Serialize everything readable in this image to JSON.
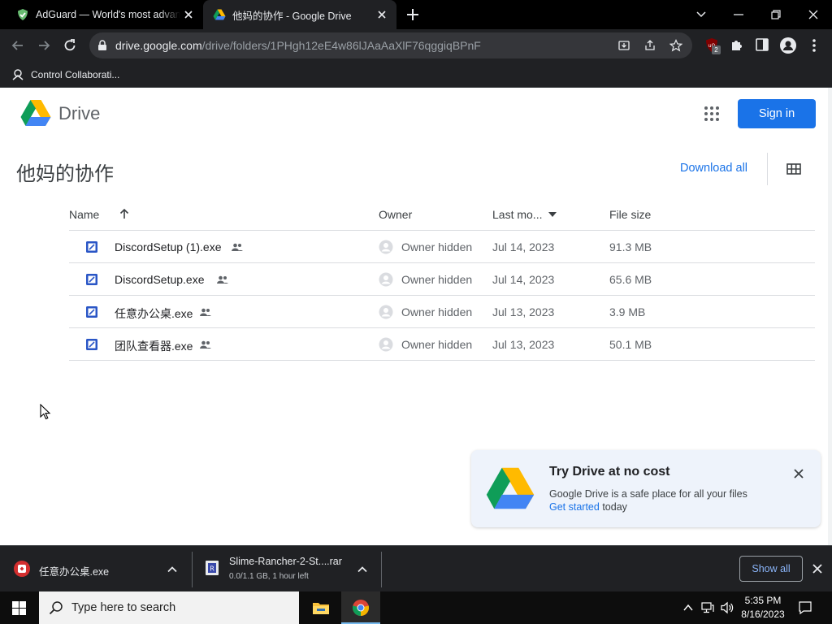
{
  "browser": {
    "tabs": [
      {
        "title": "AdGuard — World's most advanced",
        "active": false
      },
      {
        "title": "他妈的协作 - Google Drive",
        "active": true
      }
    ],
    "url_host": "drive.google.com",
    "url_path": "/drive/folders/1PHgh12eE4w86lJAaAaXlF76qggiqBPnF",
    "extension_badge": "2",
    "bookmarks": [
      {
        "label": "Control Collaborati..."
      }
    ]
  },
  "drive": {
    "brand": "Drive",
    "sign_in_label": "Sign in",
    "folder_title": "他妈的协作",
    "download_all_label": "Download all",
    "columns": {
      "name": "Name",
      "owner": "Owner",
      "last_modified": "Last mo...",
      "file_size": "File size"
    },
    "files": [
      {
        "name": "DiscordSetup (1).exe",
        "owner": "Owner hidden",
        "modified": "Jul 14, 2023",
        "size": "91.3 MB"
      },
      {
        "name": "DiscordSetup.exe",
        "owner": "Owner hidden",
        "modified": "Jul 14, 2023",
        "size": "65.6 MB"
      },
      {
        "name": "任意办公桌.exe",
        "owner": "Owner hidden",
        "modified": "Jul 13, 2023",
        "size": "3.9 MB"
      },
      {
        "name": "团队查看器.exe",
        "owner": "Owner hidden",
        "modified": "Jul 13, 2023",
        "size": "50.1 MB"
      }
    ],
    "promo": {
      "title": "Try Drive at no cost",
      "description": "Google Drive is a safe place for all your files",
      "link": "Get started",
      "link_suffix": " today"
    }
  },
  "downloads": {
    "items": [
      {
        "name": "任意办公桌.exe",
        "status": ""
      },
      {
        "name": "Slime-Rancher-2-St....rar",
        "status": "0.0/1.1 GB, 1 hour left"
      }
    ],
    "show_all_label": "Show all"
  },
  "taskbar": {
    "search_placeholder": "Type here to search",
    "time": "5:35 PM",
    "date": "8/16/2023"
  },
  "colors": {
    "accent": "#1a73e8",
    "tab_bar": "#000000",
    "toolbar": "#202124",
    "promo_bg": "#eef3fb"
  }
}
